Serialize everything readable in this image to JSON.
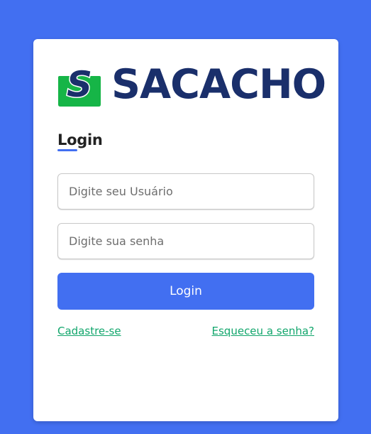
{
  "brand": {
    "name": "SACACHO",
    "logo_letter": "S",
    "colors": {
      "text": "#1a2f6b",
      "bag": "#16b547",
      "letter": "#1a2f6b"
    }
  },
  "form": {
    "title": "Login",
    "username_placeholder": "Digite seu Usuário",
    "password_placeholder": "Digite sua senha",
    "submit_label": "Login"
  },
  "links": {
    "signup": "Cadastre-se",
    "forgot": "Esqueceu a senha?"
  },
  "colors": {
    "background": "#426ff1",
    "accent": "#426ff1",
    "link": "#12a66c"
  }
}
